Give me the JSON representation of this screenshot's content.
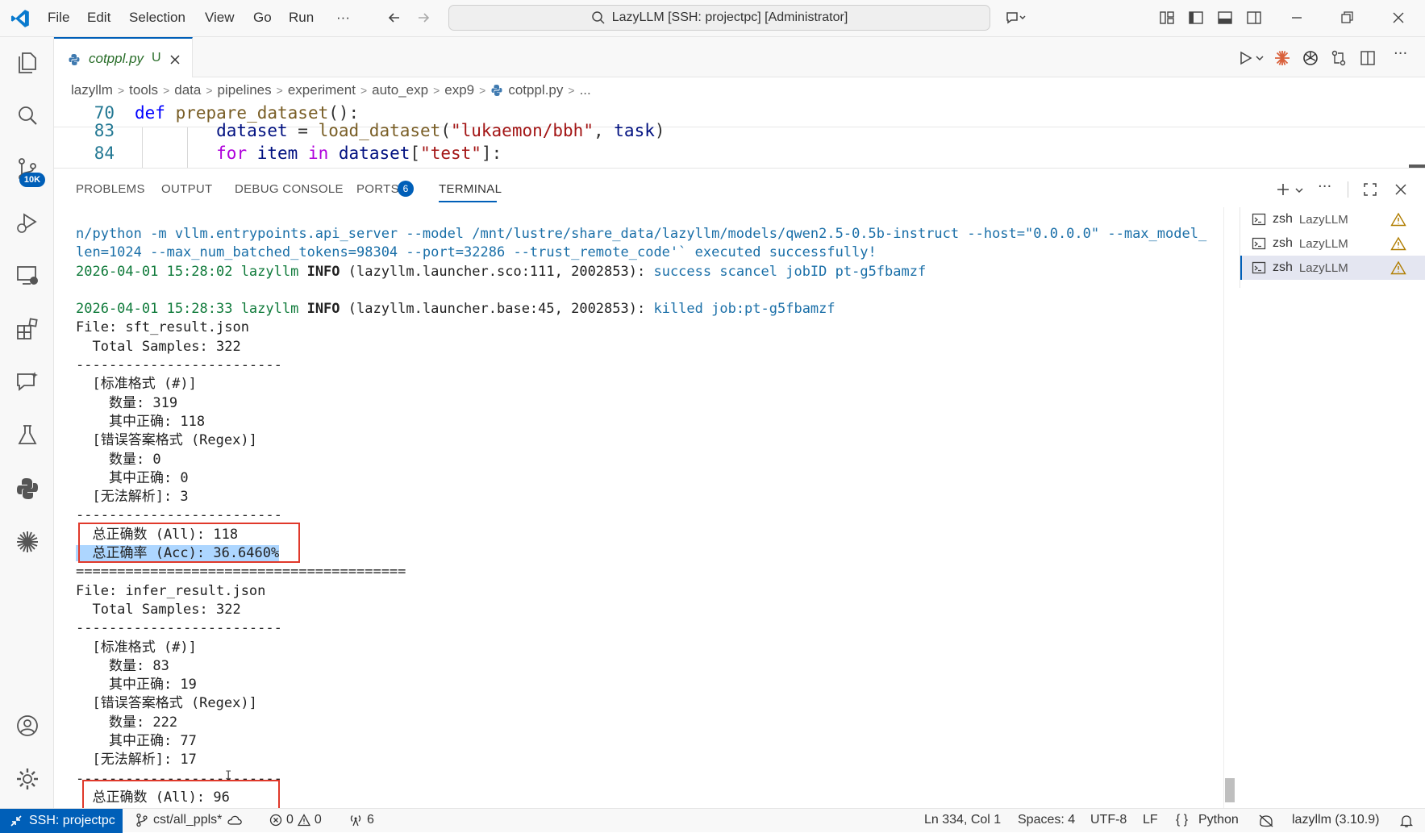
{
  "titlebar": {
    "menu": [
      "File",
      "Edit",
      "Selection",
      "View",
      "Go",
      "Run",
      "···"
    ],
    "search_text": "LazyLLM [SSH: projectpc] [Administrator]"
  },
  "activitybar": {
    "scm_badge": "10K"
  },
  "editor": {
    "tab_label": "cotppl.py",
    "tab_status": "U",
    "breadcrumbs": [
      "lazyllm",
      "tools",
      "data",
      "pipelines",
      "experiment",
      "auto_exp",
      "exp9",
      "cotppl.py",
      "..."
    ],
    "lines": [
      {
        "num": "70",
        "parts": [
          {
            "t": "def ",
            "c": "kw"
          },
          {
            "t": "prepare_dataset",
            "c": "fn"
          },
          {
            "t": "():",
            "c": ""
          }
        ]
      },
      {
        "num": "83",
        "parts": [
          {
            "t": "        dataset",
            "c": "var"
          },
          {
            "t": " = ",
            "c": ""
          },
          {
            "t": "load_dataset",
            "c": "fn"
          },
          {
            "t": "(",
            "c": ""
          },
          {
            "t": "\"lukaemon/bbh\"",
            "c": "str"
          },
          {
            "t": ", ",
            "c": ""
          },
          {
            "t": "task",
            "c": "var"
          },
          {
            "t": ")",
            "c": ""
          }
        ]
      },
      {
        "num": "84",
        "parts": [
          {
            "t": "        ",
            "c": ""
          },
          {
            "t": "for",
            "c": "ctl"
          },
          {
            "t": " item ",
            "c": "var"
          },
          {
            "t": "in",
            "c": "ctl"
          },
          {
            "t": " dataset",
            "c": "var"
          },
          {
            "t": "[",
            "c": ""
          },
          {
            "t": "\"test\"",
            "c": "str"
          },
          {
            "t": "]:",
            "c": ""
          }
        ]
      }
    ]
  },
  "panel": {
    "tabs": [
      "PROBLEMS",
      "OUTPUT",
      "DEBUG CONSOLE",
      "PORTS",
      "TERMINAL"
    ],
    "ports_badge": "6",
    "terminals": [
      {
        "shell": "zsh",
        "name": "LazyLLM"
      },
      {
        "shell": "zsh",
        "name": "LazyLLM"
      },
      {
        "shell": "zsh",
        "name": "LazyLLM"
      }
    ],
    "output": [
      [
        {
          "t": "n/python -m vllm.entrypoints.api_server --model /mnt/lustre/share_data/lazyllm/models/qwen2.5-0.5b-instruct --host=\"0.0.0.0\" --max_model_",
          "c": "c-blue"
        }
      ],
      [
        {
          "t": "len=1024 --max_num_batched_tokens=98304 --port=32286 --trust_remote_code'` executed successfully!",
          "c": "c-blue"
        }
      ],
      [
        {
          "t": "2026-04-01 15:28:02 lazyllm ",
          "c": "c-green"
        },
        {
          "t": "INFO",
          "c": "bold"
        },
        {
          "t": " (lazyllm.launcher.sco:111, 2002853): ",
          "c": ""
        },
        {
          "t": "success scancel jobID pt-g5fbamzf",
          "c": "c-blue"
        }
      ],
      [
        {
          "t": "",
          "c": ""
        }
      ],
      [
        {
          "t": "2026-04-01 15:28:33 lazyllm ",
          "c": "c-green"
        },
        {
          "t": "INFO",
          "c": "bold"
        },
        {
          "t": " (lazyllm.launcher.base:45, 2002853): ",
          "c": ""
        },
        {
          "t": "killed job:pt-g5fbamzf",
          "c": "c-blue"
        }
      ],
      [
        {
          "t": "File: sft_result.json",
          "c": ""
        }
      ],
      [
        {
          "t": "  Total Samples: 322",
          "c": ""
        }
      ],
      [
        {
          "t": "-------------------------",
          "c": ""
        }
      ],
      [
        {
          "t": "  [标准格式 (#)]",
          "c": ""
        }
      ],
      [
        {
          "t": "    数量: 319",
          "c": ""
        }
      ],
      [
        {
          "t": "    其中正确: 118",
          "c": ""
        }
      ],
      [
        {
          "t": "  [错误答案格式 (Regex)]",
          "c": ""
        }
      ],
      [
        {
          "t": "    数量: 0",
          "c": ""
        }
      ],
      [
        {
          "t": "    其中正确: 0",
          "c": ""
        }
      ],
      [
        {
          "t": "  [无法解析]: 3",
          "c": ""
        }
      ],
      [
        {
          "t": "-------------------------",
          "c": ""
        }
      ],
      [
        {
          "t": "  总正确数 (All): 118",
          "c": ""
        }
      ],
      [
        {
          "t": "  总正确率 (Acc): 36.6460%",
          "c": "hl"
        }
      ],
      [
        {
          "t": "========================================",
          "c": ""
        }
      ],
      [
        {
          "t": "File: infer_result.json",
          "c": ""
        }
      ],
      [
        {
          "t": "  Total Samples: 322",
          "c": ""
        }
      ],
      [
        {
          "t": "-------------------------",
          "c": ""
        }
      ],
      [
        {
          "t": "  [标准格式 (#)]",
          "c": ""
        }
      ],
      [
        {
          "t": "    数量: 83",
          "c": ""
        }
      ],
      [
        {
          "t": "    其中正确: 19",
          "c": ""
        }
      ],
      [
        {
          "t": "  [错误答案格式 (Regex)]",
          "c": ""
        }
      ],
      [
        {
          "t": "    数量: 222",
          "c": ""
        }
      ],
      [
        {
          "t": "    其中正确: 77",
          "c": ""
        }
      ],
      [
        {
          "t": "  [无法解析]: 17",
          "c": ""
        }
      ],
      [
        {
          "t": "-------------------------",
          "c": ""
        }
      ],
      [
        {
          "t": "  总正确数 (All): 96",
          "c": ""
        }
      ]
    ]
  },
  "statusbar": {
    "remote": "SSH: projectpc",
    "branch": "cst/all_ppls*",
    "errors": "0",
    "warnings": "0",
    "ports": "6",
    "position": "Ln 334, Col 1",
    "spaces": "Spaces: 4",
    "encoding": "UTF-8",
    "eol": "LF",
    "language": "Python",
    "interpreter": "lazyllm (3.10.9)"
  },
  "colors": {
    "accent": "#005fb8",
    "highlight_box": "#e0392b",
    "selection": "#add6ff"
  }
}
